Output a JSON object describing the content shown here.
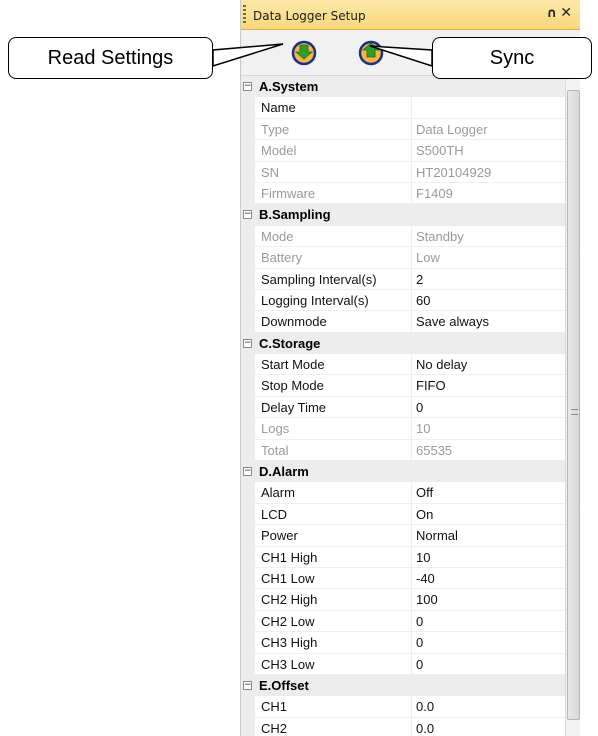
{
  "panel": {
    "title": "Data Logger Setup",
    "pin_glyph": "∩",
    "close_glyph": "✕"
  },
  "toolbar": {
    "read_icon": "download-arrow-icon",
    "sync_icon": "upload-arrow-icon",
    "accent_green": "#2e9e2e",
    "accent_orange": "#f0a020"
  },
  "callouts": {
    "read_settings": "Read Settings",
    "sync": "Sync"
  },
  "grid": [
    {
      "category": "A.System",
      "rows": [
        {
          "name": "Name",
          "value": "",
          "readonly": false
        },
        {
          "name": "Type",
          "value": "Data Logger",
          "readonly": true
        },
        {
          "name": "Model",
          "value": "S500TH",
          "readonly": true
        },
        {
          "name": "SN",
          "value": "HT20104929",
          "readonly": true
        },
        {
          "name": "Firmware",
          "value": "F1409",
          "readonly": true
        }
      ]
    },
    {
      "category": "B.Sampling",
      "rows": [
        {
          "name": "Mode",
          "value": "Standby",
          "readonly": true
        },
        {
          "name": "Battery",
          "value": "Low",
          "readonly": true
        },
        {
          "name": "Sampling Interval(s)",
          "value": "2",
          "readonly": false
        },
        {
          "name": "Logging Interval(s)",
          "value": "60",
          "readonly": false
        },
        {
          "name": "Downmode",
          "value": "Save always",
          "readonly": false
        }
      ]
    },
    {
      "category": "C.Storage",
      "rows": [
        {
          "name": "Start Mode",
          "value": "No delay",
          "readonly": false
        },
        {
          "name": "Stop Mode",
          "value": "FIFO",
          "readonly": false
        },
        {
          "name": "Delay Time",
          "value": "0",
          "readonly": false
        },
        {
          "name": "Logs",
          "value": "10",
          "readonly": true
        },
        {
          "name": "Total",
          "value": "65535",
          "readonly": true
        }
      ]
    },
    {
      "category": "D.Alarm",
      "rows": [
        {
          "name": "Alarm",
          "value": "Off",
          "readonly": false
        },
        {
          "name": "LCD",
          "value": "On",
          "readonly": false
        },
        {
          "name": "Power",
          "value": "Normal",
          "readonly": false
        },
        {
          "name": "CH1 High",
          "value": "10",
          "readonly": false
        },
        {
          "name": "CH1 Low",
          "value": "-40",
          "readonly": false
        },
        {
          "name": "CH2 High",
          "value": "100",
          "readonly": false
        },
        {
          "name": "CH2 Low",
          "value": "0",
          "readonly": false
        },
        {
          "name": "CH3 High",
          "value": "0",
          "readonly": false
        },
        {
          "name": "CH3 Low",
          "value": "0",
          "readonly": false
        }
      ]
    },
    {
      "category": "E.Offset",
      "rows": [
        {
          "name": "CH1",
          "value": "0.0",
          "readonly": false
        },
        {
          "name": "CH2",
          "value": "0.0",
          "readonly": false
        }
      ]
    }
  ]
}
